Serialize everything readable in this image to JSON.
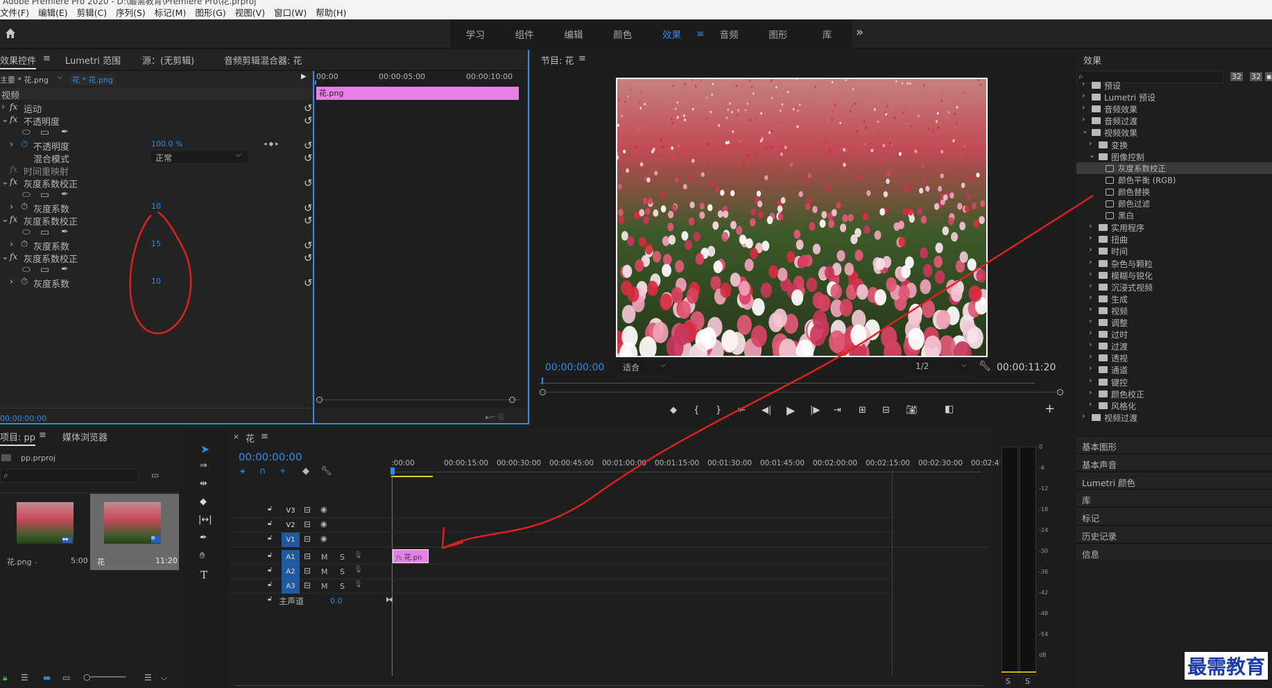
{
  "app": {
    "title": "Adobe Premiere Pro 2020 - D:\\最需教育\\Premiere Pro\\花.prproj"
  },
  "menu": [
    "文件(F)",
    "编辑(E)",
    "剪辑(C)",
    "序列(S)",
    "标记(M)",
    "图形(G)",
    "视图(V)",
    "窗口(W)",
    "帮助(H)"
  ],
  "workspaces": {
    "items": [
      "学习",
      "组件",
      "编辑",
      "颜色",
      "效果",
      "音频",
      "图形",
      "库"
    ],
    "active": "效果",
    "more": "»"
  },
  "effect_controls": {
    "tabs": [
      "效果控件",
      "Lumetri 范围",
      "源：(无剪辑)",
      "音频剪辑混合器: 花"
    ],
    "master": "主要 * 花.png",
    "clip": "花 * 花.png",
    "section": "视频",
    "motion": "运动",
    "opacity": "不透明度",
    "opacity_prop": "不透明度",
    "opacity_value": "100.0 %",
    "blend_mode_label": "混合模式",
    "blend_mode_value": "正常",
    "time_remap": "时间重映射",
    "gamma_effects": [
      {
        "name": "灰度系数校正",
        "param": "灰度系数",
        "value": "10"
      },
      {
        "name": "灰度系数校正",
        "param": "灰度系数",
        "value": "15"
      },
      {
        "name": "灰度系数校正",
        "param": "灰度系数",
        "value": "10"
      }
    ],
    "timecode": "00:00:00:00",
    "ruler": [
      "00:00",
      "00:00:05:00",
      "00:00:10:00"
    ],
    "clip_bar": "花.png"
  },
  "program": {
    "title": "节目: 花",
    "timecode": "00:00:00:00",
    "fit": "适合",
    "res": "1/2",
    "duration": "00:00:11:20"
  },
  "project": {
    "tabs": [
      "项目: pp",
      "媒体浏览器"
    ],
    "file": "pp.prproj",
    "items": [
      {
        "name": "花.png",
        "extra": ".",
        "dur": "5:00"
      },
      {
        "name": "花",
        "dur": "11:20"
      }
    ]
  },
  "timeline": {
    "tab": "花",
    "timecode": "00:00:00:00",
    "ruler": [
      ":00:00",
      "00:00:15:00",
      "00:00:30:00",
      "00:00:45:00",
      "00:01:00:00",
      "00:01:15:00",
      "00:01:30:00",
      "00:01:45:00",
      "00:02:00:00",
      "00:02:15:00",
      "00:02:30:00",
      "00:02:45:"
    ],
    "video_tracks": [
      "V3",
      "V2",
      "V1"
    ],
    "audio_tracks": [
      "A1",
      "A2",
      "A3"
    ],
    "mute": "M",
    "solo": "S",
    "master": "主声道",
    "master_value": "0.0",
    "clip": "花.pn"
  },
  "meter": {
    "scale": [
      "0",
      "-6",
      "-12",
      "-18",
      "-24",
      "-30",
      "-36",
      "-42",
      "-48",
      "-54",
      "dB"
    ],
    "solo": [
      "S",
      "S"
    ]
  },
  "effects_panel": {
    "title": "效果",
    "tree": [
      {
        "label": "预设",
        "indent": 0,
        "type": "folder"
      },
      {
        "label": "Lumetri 预设",
        "indent": 0,
        "type": "folder"
      },
      {
        "label": "音频效果",
        "indent": 0,
        "type": "folder"
      },
      {
        "label": "音频过渡",
        "indent": 0,
        "type": "folder"
      },
      {
        "label": "视频效果",
        "indent": 0,
        "type": "folder",
        "open": true
      },
      {
        "label": "变换",
        "indent": 1,
        "type": "folder"
      },
      {
        "label": "图像控制",
        "indent": 1,
        "type": "folder",
        "open": true
      },
      {
        "label": "灰度系数校正",
        "indent": 2,
        "type": "preset",
        "selected": true
      },
      {
        "label": "颜色平衡 (RGB)",
        "indent": 2,
        "type": "preset"
      },
      {
        "label": "颜色替换",
        "indent": 2,
        "type": "preset"
      },
      {
        "label": "颜色过滤",
        "indent": 2,
        "type": "preset"
      },
      {
        "label": "黑白",
        "indent": 2,
        "type": "preset"
      },
      {
        "label": "实用程序",
        "indent": 1,
        "type": "folder"
      },
      {
        "label": "扭曲",
        "indent": 1,
        "type": "folder"
      },
      {
        "label": "时间",
        "indent": 1,
        "type": "folder"
      },
      {
        "label": "杂色与颗粒",
        "indent": 1,
        "type": "folder"
      },
      {
        "label": "模糊与锐化",
        "indent": 1,
        "type": "folder"
      },
      {
        "label": "沉浸式视频",
        "indent": 1,
        "type": "folder"
      },
      {
        "label": "生成",
        "indent": 1,
        "type": "folder"
      },
      {
        "label": "视频",
        "indent": 1,
        "type": "folder"
      },
      {
        "label": "调整",
        "indent": 1,
        "type": "folder"
      },
      {
        "label": "过时",
        "indent": 1,
        "type": "folder"
      },
      {
        "label": "过渡",
        "indent": 1,
        "type": "folder"
      },
      {
        "label": "透视",
        "indent": 1,
        "type": "folder"
      },
      {
        "label": "通道",
        "indent": 1,
        "type": "folder"
      },
      {
        "label": "键控",
        "indent": 1,
        "type": "folder"
      },
      {
        "label": "颜色校正",
        "indent": 1,
        "type": "folder"
      },
      {
        "label": "风格化",
        "indent": 1,
        "type": "folder"
      },
      {
        "label": "视频过渡",
        "indent": 0,
        "type": "folder"
      }
    ],
    "sections": [
      "基本图形",
      "基本声音",
      "Lumetri 颜色",
      "库",
      "标记",
      "历史记录",
      "信息"
    ]
  },
  "watermark": "最需教育",
  "colors": {
    "accent": "#2d8ceb",
    "clip": "#e97fe4",
    "annotation": "#e02020"
  }
}
